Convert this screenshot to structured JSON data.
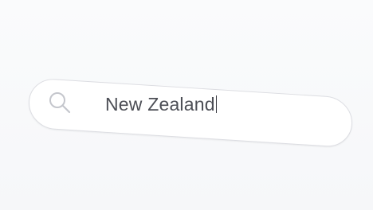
{
  "search": {
    "value": "New Zealand",
    "icon": "search-icon"
  },
  "colors": {
    "background": "#f8f9fb",
    "pill": "#ffffff",
    "border": "#dcdde2",
    "text": "#4c4e55"
  }
}
